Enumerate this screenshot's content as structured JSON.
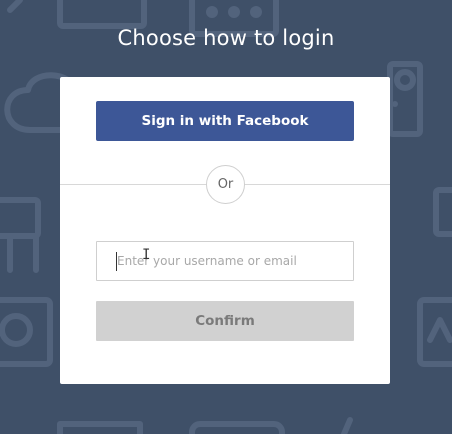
{
  "page": {
    "title": "Choose how to login"
  },
  "login": {
    "facebook_label": "Sign in with Facebook",
    "or_label": "Or",
    "input_placeholder": "Enter your username or email",
    "input_value": "",
    "confirm_label": "Confirm"
  },
  "colors": {
    "background": "#3f5068",
    "facebook_blue": "#3d5797",
    "confirm_disabled": "#d1d1d1"
  },
  "icons": {
    "background_pattern": "decorative-line-icons",
    "cursor": "text-ibeam-cursor"
  }
}
